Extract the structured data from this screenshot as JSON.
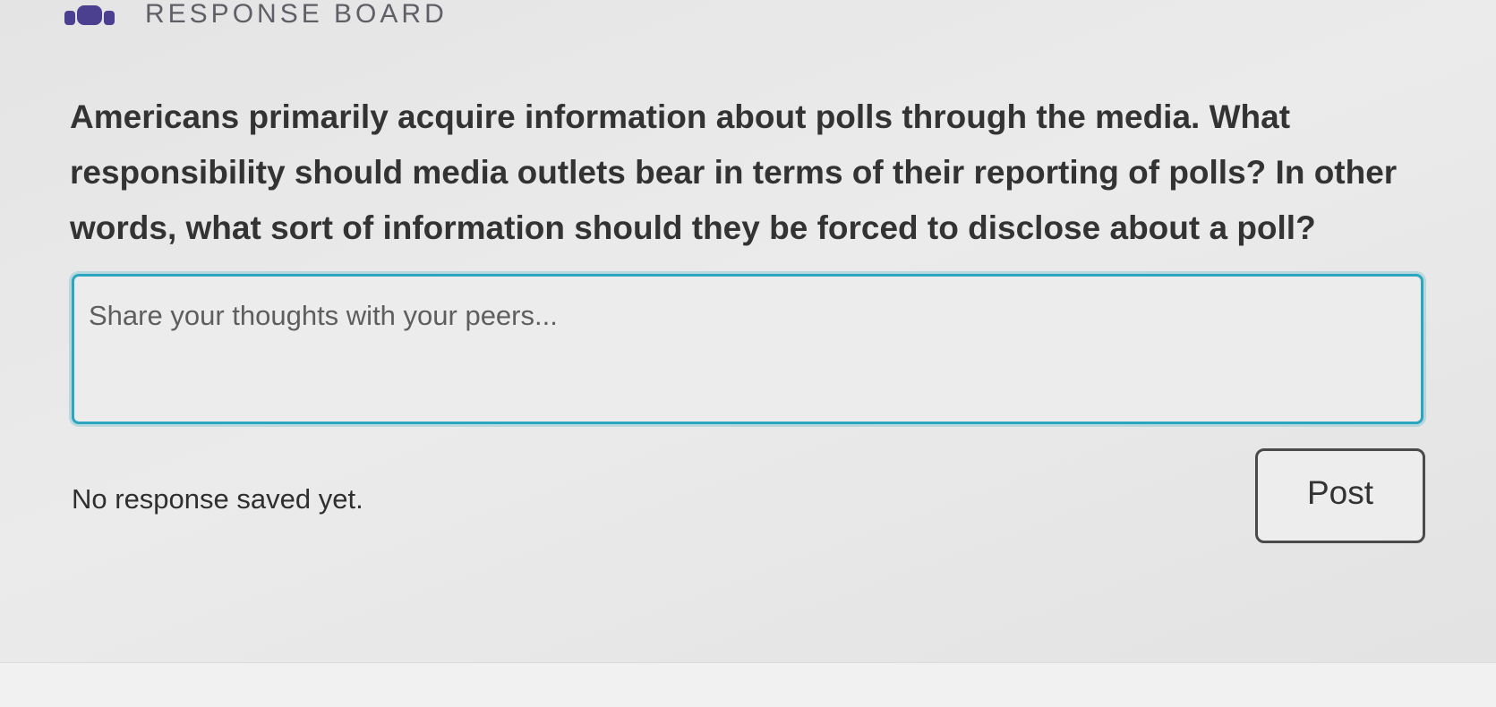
{
  "header": {
    "icon": "group-people-icon",
    "title": "RESPONSE BOARD"
  },
  "question": {
    "text": "Americans primarily acquire information about polls through the media. What responsibility should media outlets bear in terms of their reporting of polls? In other words, what sort of information should they be forced to disclose about a poll?"
  },
  "response": {
    "placeholder": "Share your thoughts with your peers...",
    "value": ""
  },
  "status": {
    "text": "No response saved yet."
  },
  "actions": {
    "post_label": "Post"
  },
  "colors": {
    "accent": "#2aa6c0",
    "icon": "#4b3f8f",
    "title": "#5f5f66"
  }
}
